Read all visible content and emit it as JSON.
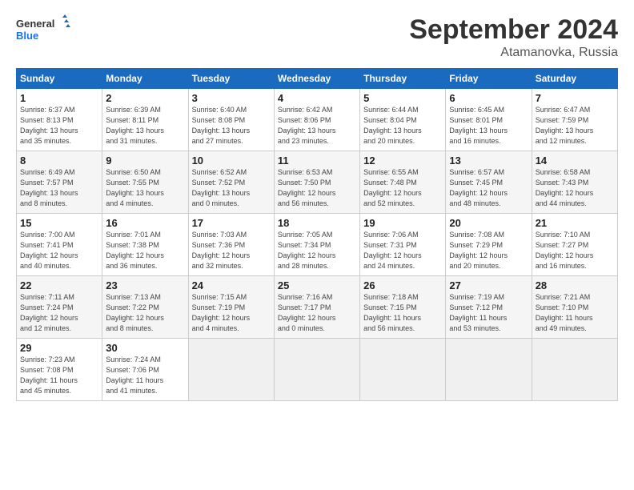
{
  "header": {
    "logo_general": "General",
    "logo_blue": "Blue",
    "month_title": "September 2024",
    "subtitle": "Atamanovka, Russia"
  },
  "days_of_week": [
    "Sunday",
    "Monday",
    "Tuesday",
    "Wednesday",
    "Thursday",
    "Friday",
    "Saturday"
  ],
  "weeks": [
    [
      {
        "day": "1",
        "info": "Sunrise: 6:37 AM\nSunset: 8:13 PM\nDaylight: 13 hours\nand 35 minutes."
      },
      {
        "day": "2",
        "info": "Sunrise: 6:39 AM\nSunset: 8:11 PM\nDaylight: 13 hours\nand 31 minutes."
      },
      {
        "day": "3",
        "info": "Sunrise: 6:40 AM\nSunset: 8:08 PM\nDaylight: 13 hours\nand 27 minutes."
      },
      {
        "day": "4",
        "info": "Sunrise: 6:42 AM\nSunset: 8:06 PM\nDaylight: 13 hours\nand 23 minutes."
      },
      {
        "day": "5",
        "info": "Sunrise: 6:44 AM\nSunset: 8:04 PM\nDaylight: 13 hours\nand 20 minutes."
      },
      {
        "day": "6",
        "info": "Sunrise: 6:45 AM\nSunset: 8:01 PM\nDaylight: 13 hours\nand 16 minutes."
      },
      {
        "day": "7",
        "info": "Sunrise: 6:47 AM\nSunset: 7:59 PM\nDaylight: 13 hours\nand 12 minutes."
      }
    ],
    [
      {
        "day": "8",
        "info": "Sunrise: 6:49 AM\nSunset: 7:57 PM\nDaylight: 13 hours\nand 8 minutes."
      },
      {
        "day": "9",
        "info": "Sunrise: 6:50 AM\nSunset: 7:55 PM\nDaylight: 13 hours\nand 4 minutes."
      },
      {
        "day": "10",
        "info": "Sunrise: 6:52 AM\nSunset: 7:52 PM\nDaylight: 13 hours\nand 0 minutes."
      },
      {
        "day": "11",
        "info": "Sunrise: 6:53 AM\nSunset: 7:50 PM\nDaylight: 12 hours\nand 56 minutes."
      },
      {
        "day": "12",
        "info": "Sunrise: 6:55 AM\nSunset: 7:48 PM\nDaylight: 12 hours\nand 52 minutes."
      },
      {
        "day": "13",
        "info": "Sunrise: 6:57 AM\nSunset: 7:45 PM\nDaylight: 12 hours\nand 48 minutes."
      },
      {
        "day": "14",
        "info": "Sunrise: 6:58 AM\nSunset: 7:43 PM\nDaylight: 12 hours\nand 44 minutes."
      }
    ],
    [
      {
        "day": "15",
        "info": "Sunrise: 7:00 AM\nSunset: 7:41 PM\nDaylight: 12 hours\nand 40 minutes."
      },
      {
        "day": "16",
        "info": "Sunrise: 7:01 AM\nSunset: 7:38 PM\nDaylight: 12 hours\nand 36 minutes."
      },
      {
        "day": "17",
        "info": "Sunrise: 7:03 AM\nSunset: 7:36 PM\nDaylight: 12 hours\nand 32 minutes."
      },
      {
        "day": "18",
        "info": "Sunrise: 7:05 AM\nSunset: 7:34 PM\nDaylight: 12 hours\nand 28 minutes."
      },
      {
        "day": "19",
        "info": "Sunrise: 7:06 AM\nSunset: 7:31 PM\nDaylight: 12 hours\nand 24 minutes."
      },
      {
        "day": "20",
        "info": "Sunrise: 7:08 AM\nSunset: 7:29 PM\nDaylight: 12 hours\nand 20 minutes."
      },
      {
        "day": "21",
        "info": "Sunrise: 7:10 AM\nSunset: 7:27 PM\nDaylight: 12 hours\nand 16 minutes."
      }
    ],
    [
      {
        "day": "22",
        "info": "Sunrise: 7:11 AM\nSunset: 7:24 PM\nDaylight: 12 hours\nand 12 minutes."
      },
      {
        "day": "23",
        "info": "Sunrise: 7:13 AM\nSunset: 7:22 PM\nDaylight: 12 hours\nand 8 minutes."
      },
      {
        "day": "24",
        "info": "Sunrise: 7:15 AM\nSunset: 7:19 PM\nDaylight: 12 hours\nand 4 minutes."
      },
      {
        "day": "25",
        "info": "Sunrise: 7:16 AM\nSunset: 7:17 PM\nDaylight: 12 hours\nand 0 minutes."
      },
      {
        "day": "26",
        "info": "Sunrise: 7:18 AM\nSunset: 7:15 PM\nDaylight: 11 hours\nand 56 minutes."
      },
      {
        "day": "27",
        "info": "Sunrise: 7:19 AM\nSunset: 7:12 PM\nDaylight: 11 hours\nand 53 minutes."
      },
      {
        "day": "28",
        "info": "Sunrise: 7:21 AM\nSunset: 7:10 PM\nDaylight: 11 hours\nand 49 minutes."
      }
    ],
    [
      {
        "day": "29",
        "info": "Sunrise: 7:23 AM\nSunset: 7:08 PM\nDaylight: 11 hours\nand 45 minutes."
      },
      {
        "day": "30",
        "info": "Sunrise: 7:24 AM\nSunset: 7:06 PM\nDaylight: 11 hours\nand 41 minutes."
      },
      {
        "day": "",
        "info": ""
      },
      {
        "day": "",
        "info": ""
      },
      {
        "day": "",
        "info": ""
      },
      {
        "day": "",
        "info": ""
      },
      {
        "day": "",
        "info": ""
      }
    ]
  ]
}
